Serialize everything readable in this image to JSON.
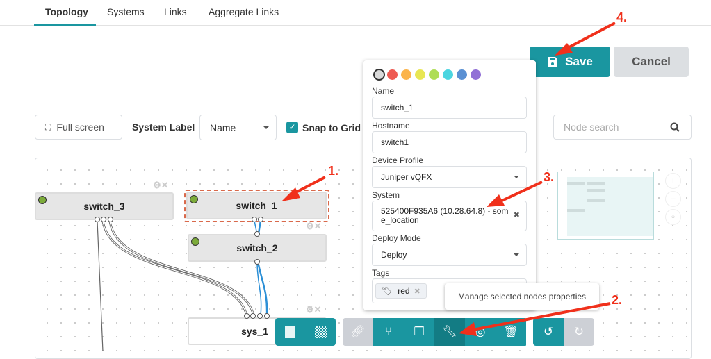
{
  "tabs": [
    {
      "label": "Topology",
      "active": true
    },
    {
      "label": "Systems"
    },
    {
      "label": "Links"
    },
    {
      "label": "Aggregate Links"
    }
  ],
  "actions": {
    "save": "Save",
    "cancel": "Cancel",
    "save_icon": "floppy-disk-icon"
  },
  "toolbar": {
    "full_screen": "Full screen",
    "system_label": "System Label",
    "system_label_value": "Name",
    "snap_to_grid": "Snap to Grid",
    "snap_checked": true,
    "node_search_placeholder": "Node search"
  },
  "nodes": [
    {
      "name": "switch_3"
    },
    {
      "name": "switch_1",
      "selected": true
    },
    {
      "name": "switch_2"
    },
    {
      "name": "sys_1"
    }
  ],
  "properties": {
    "colors": [
      "#d9d9d9",
      "#ee5a52",
      "#fbb44b",
      "#e8e653",
      "#aedd55",
      "#4bd5e0",
      "#5a90d3",
      "#9170d6"
    ],
    "name_label": "Name",
    "name_value": "switch_1",
    "hostname_label": "Hostname",
    "hostname_value": "switch1",
    "device_profile_label": "Device Profile",
    "device_profile_value": "Juniper vQFX",
    "system_label": "System",
    "system_value": "525400F935A6 (10.28.64.8) - some_location",
    "deploy_mode_label": "Deploy Mode",
    "deploy_mode_value": "Deploy",
    "tags_label": "Tags",
    "tags": [
      "red"
    ]
  },
  "tooltip": "Manage selected nodes properties",
  "annotations": [
    "1.",
    "2.",
    "3.",
    "4."
  ],
  "colors": {
    "accent": "#1a96a0",
    "annotation": "#f0301b",
    "selection": "#d9694b"
  }
}
